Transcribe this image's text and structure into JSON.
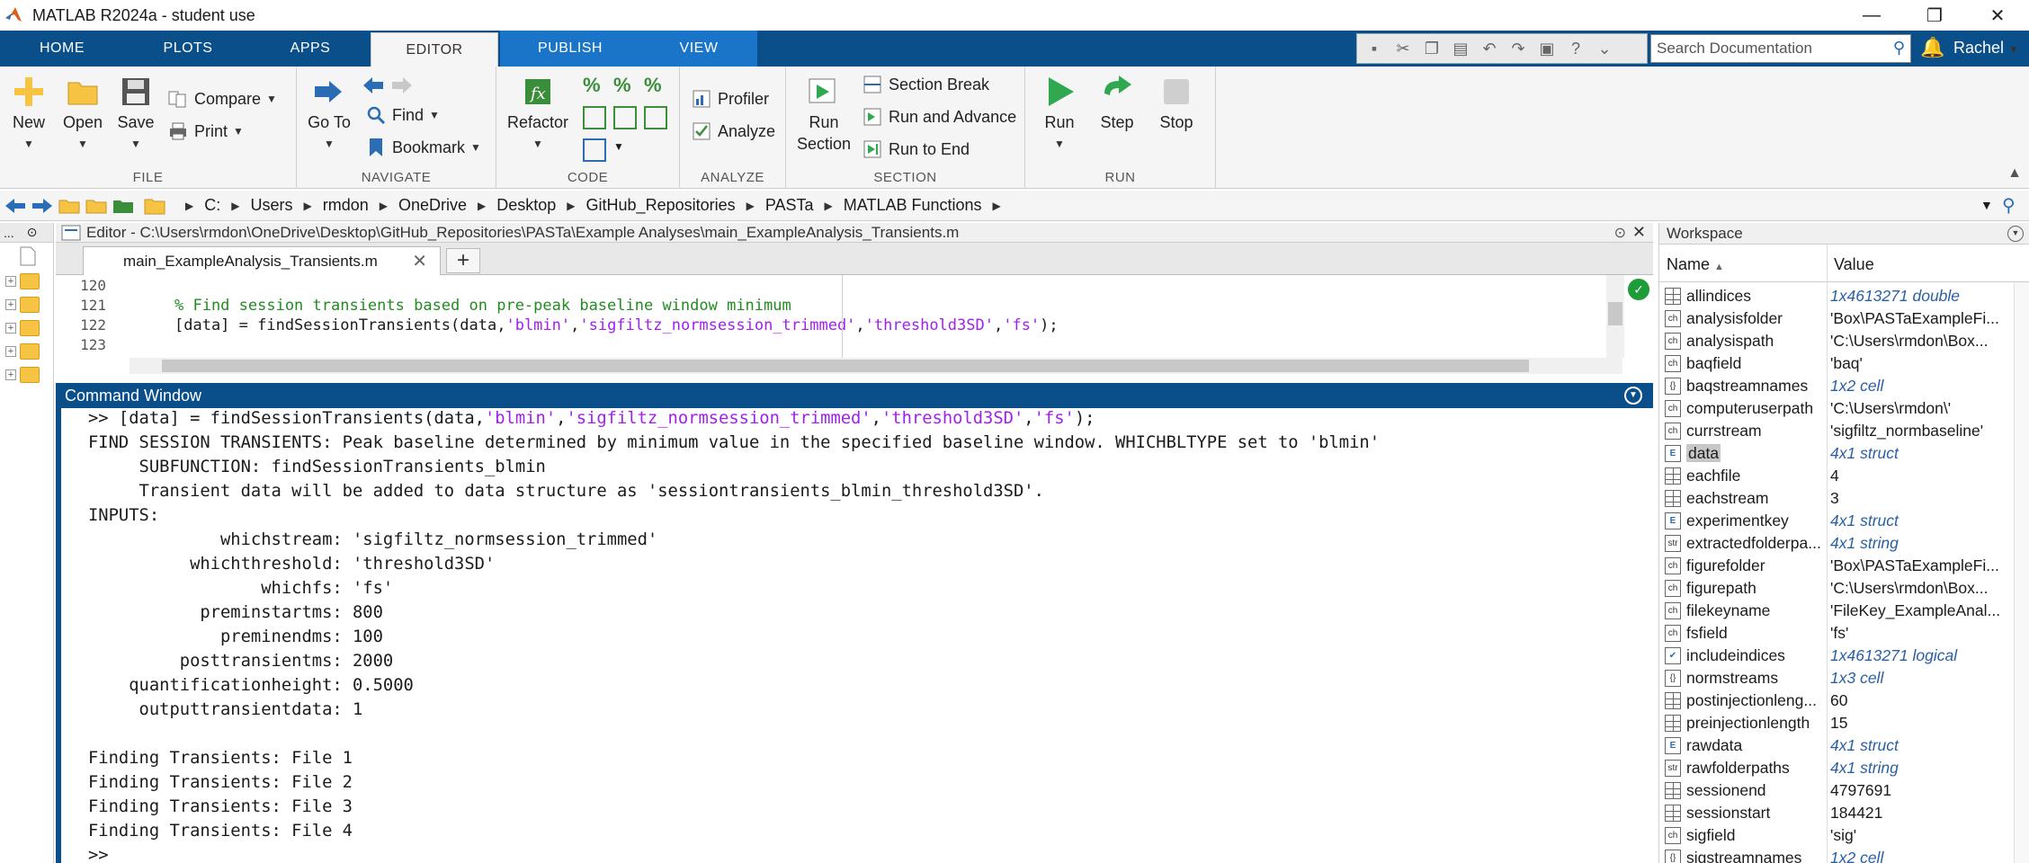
{
  "window": {
    "title": "MATLAB R2024a - student use",
    "controls": {
      "minimize": "—",
      "restore": "❐",
      "close": "✕"
    }
  },
  "tabs": {
    "home": "HOME",
    "plots": "PLOTS",
    "apps": "APPS",
    "editor": "EDITOR",
    "publish": "PUBLISH",
    "view": "VIEW"
  },
  "search": {
    "placeholder": "Search Documentation"
  },
  "user": {
    "name": "Rachel"
  },
  "toolstrip": {
    "file": {
      "label": "FILE",
      "new": "New",
      "open": "Open",
      "save": "Save",
      "compare": "Compare",
      "print": "Print"
    },
    "navigate": {
      "label": "NAVIGATE",
      "goto_line1": "Go To",
      "find": "Find",
      "bookmark": "Bookmark"
    },
    "code": {
      "label": "CODE",
      "refactor": "Refactor"
    },
    "analyze": {
      "label": "ANALYZE",
      "profiler": "Profiler",
      "analyze": "Analyze"
    },
    "section": {
      "label": "SECTION",
      "run_section_1": "Run",
      "run_section_2": "Section",
      "section_break": "Section Break",
      "run_and_advance": "Run and Advance",
      "run_to_end": "Run to End"
    },
    "run": {
      "label": "RUN",
      "run": "Run",
      "step": "Step",
      "stop": "Stop"
    }
  },
  "breadcrumbs": [
    "C:",
    "Users",
    "rmdon",
    "OneDrive",
    "Desktop",
    "GitHub_Repositories",
    "PASTa",
    "MATLAB Functions"
  ],
  "filebrowser": {
    "header": "..."
  },
  "editor": {
    "header": "Editor - C:\\Users\\rmdon\\OneDrive\\Desktop\\GitHub_Repositories\\PASTa\\Example Analyses\\main_ExampleAnalysis_Transients.m",
    "tab": "main_ExampleAnalysis_Transients.m",
    "lines": [
      {
        "num": "120",
        "parts": []
      },
      {
        "num": "121",
        "parts": [
          {
            "t": "% Find session transients based on pre-peak baseline window minimum",
            "c": "cm"
          }
        ]
      },
      {
        "num": "122",
        "parts": [
          {
            "t": "[data] = findSessionTransients(data,",
            "c": ""
          },
          {
            "t": "'blmin'",
            "c": "str"
          },
          {
            "t": ",",
            "c": ""
          },
          {
            "t": "'sigfiltz_normsession_trimmed'",
            "c": "str"
          },
          {
            "t": ",",
            "c": ""
          },
          {
            "t": "'threshold3SD'",
            "c": "str"
          },
          {
            "t": ",",
            "c": ""
          },
          {
            "t": "'fs'",
            "c": "str"
          },
          {
            "t": ");",
            "c": ""
          }
        ]
      },
      {
        "num": "123",
        "parts": []
      }
    ]
  },
  "command_window": {
    "title": "Command Window",
    "lines": [
      [
        {
          "t": ">> [data] = findSessionTransients(data,",
          "c": ""
        },
        {
          "t": "'blmin'",
          "c": "str"
        },
        {
          "t": ",",
          "c": ""
        },
        {
          "t": "'sigfiltz_normsession_trimmed'",
          "c": "str"
        },
        {
          "t": ",",
          "c": ""
        },
        {
          "t": "'threshold3SD'",
          "c": "str"
        },
        {
          "t": ",",
          "c": ""
        },
        {
          "t": "'fs'",
          "c": "str"
        },
        {
          "t": ");",
          "c": ""
        }
      ],
      [
        {
          "t": "FIND SESSION TRANSIENTS: Peak baseline determined by minimum value in the specified baseline window. WHICHBLTYPE set to 'blmin'",
          "c": ""
        }
      ],
      [
        {
          "t": "     SUBFUNCTION: findSessionTransients_blmin",
          "c": ""
        }
      ],
      [
        {
          "t": "     Transient data will be added to data structure as 'sessiontransients_blmin_threshold3SD'.",
          "c": ""
        }
      ],
      [
        {
          "t": "INPUTS:",
          "c": ""
        }
      ],
      [
        {
          "t": "             whichstream: 'sigfiltz_normsession_trimmed'",
          "c": ""
        }
      ],
      [
        {
          "t": "          whichthreshold: 'threshold3SD'",
          "c": ""
        }
      ],
      [
        {
          "t": "                 whichfs: 'fs'",
          "c": ""
        }
      ],
      [
        {
          "t": "           preminstartms: 800",
          "c": ""
        }
      ],
      [
        {
          "t": "             preminendms: 100",
          "c": ""
        }
      ],
      [
        {
          "t": "         posttransientms: 2000",
          "c": ""
        }
      ],
      [
        {
          "t": "    quantificationheight: 0.5000",
          "c": ""
        }
      ],
      [
        {
          "t": "     outputtransientdata: 1",
          "c": ""
        }
      ],
      [
        {
          "t": "",
          "c": ""
        }
      ],
      [
        {
          "t": "Finding Transients: File 1",
          "c": ""
        }
      ],
      [
        {
          "t": "Finding Transients: File 2",
          "c": ""
        }
      ],
      [
        {
          "t": "Finding Transients: File 3",
          "c": ""
        }
      ],
      [
        {
          "t": "Finding Transients: File 4",
          "c": ""
        }
      ],
      [
        {
          "t": ">>",
          "c": ""
        }
      ]
    ]
  },
  "workspace": {
    "title": "Workspace",
    "col_name": "Name",
    "col_value": "Value",
    "vars": [
      {
        "icon": "grid",
        "name": "allindices",
        "value": "1x4613271 double",
        "italic": true
      },
      {
        "icon": "ch",
        "name": "analysisfolder",
        "value": "'Box\\PASTaExampleFi...",
        "italic": false
      },
      {
        "icon": "ch",
        "name": "analysispath",
        "value": "'C:\\Users\\rmdon\\Box...",
        "italic": false
      },
      {
        "icon": "ch",
        "name": "baqfield",
        "value": "'baq'",
        "italic": false
      },
      {
        "icon": "cell",
        "name": "baqstreamnames",
        "value": "1x2 cell",
        "italic": true
      },
      {
        "icon": "ch",
        "name": "computeruserpath",
        "value": "'C:\\Users\\rmdon\\'",
        "italic": false
      },
      {
        "icon": "ch",
        "name": "currstream",
        "value": "'sigfiltz_normbaseline'",
        "italic": false
      },
      {
        "icon": "struct",
        "name": "data",
        "value": "4x1 struct",
        "italic": true,
        "selected": true
      },
      {
        "icon": "grid",
        "name": "eachfile",
        "value": "4",
        "italic": false
      },
      {
        "icon": "grid",
        "name": "eachstream",
        "value": "3",
        "italic": false
      },
      {
        "icon": "struct",
        "name": "experimentkey",
        "value": "4x1 struct",
        "italic": true
      },
      {
        "icon": "str",
        "name": "extractedfolderpa...",
        "value": "4x1 string",
        "italic": true
      },
      {
        "icon": "ch",
        "name": "figurefolder",
        "value": "'Box\\PASTaExampleFi...",
        "italic": false
      },
      {
        "icon": "ch",
        "name": "figurepath",
        "value": "'C:\\Users\\rmdon\\Box...",
        "italic": false
      },
      {
        "icon": "ch",
        "name": "filekeyname",
        "value": "'FileKey_ExampleAnal...",
        "italic": false
      },
      {
        "icon": "ch",
        "name": "fsfield",
        "value": "'fs'",
        "italic": false
      },
      {
        "icon": "check",
        "name": "includeindices",
        "value": "1x4613271 logical",
        "italic": true
      },
      {
        "icon": "cell",
        "name": "normstreams",
        "value": "1x3 cell",
        "italic": true
      },
      {
        "icon": "grid",
        "name": "postinjectionleng...",
        "value": "60",
        "italic": false
      },
      {
        "icon": "grid",
        "name": "preinjectionlength",
        "value": "15",
        "italic": false
      },
      {
        "icon": "struct",
        "name": "rawdata",
        "value": "4x1 struct",
        "italic": true
      },
      {
        "icon": "str",
        "name": "rawfolderpaths",
        "value": "4x1 string",
        "italic": true
      },
      {
        "icon": "grid",
        "name": "sessionend",
        "value": "4797691",
        "italic": false
      },
      {
        "icon": "grid",
        "name": "sessionstart",
        "value": "184421",
        "italic": false
      },
      {
        "icon": "ch",
        "name": "sigfield",
        "value": "'sig'",
        "italic": false
      },
      {
        "icon": "cell",
        "name": "sigstreamnames",
        "value": "1x2 cell",
        "italic": true
      }
    ]
  },
  "colors": {
    "tabstrip": "#0b4f8a",
    "string": "#a020f0",
    "comment": "#228b22",
    "run_green": "#2fa84f"
  }
}
